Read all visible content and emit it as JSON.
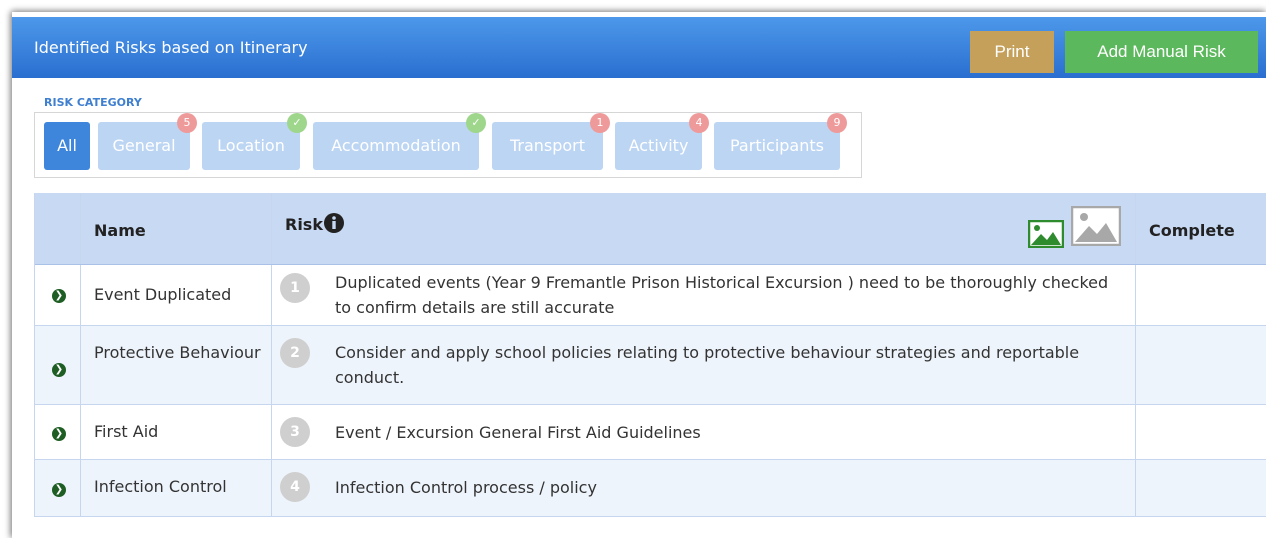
{
  "header": {
    "title": "Identified Risks based on Itinerary",
    "print_label": "Print",
    "add_label": "Add Manual Risk"
  },
  "categories": {
    "label": "RISK CATEGORY",
    "items": [
      {
        "label": "All",
        "active": true,
        "badge": ""
      },
      {
        "label": "General",
        "active": false,
        "badge": "5",
        "badge_type": "count"
      },
      {
        "label": "Location",
        "active": false,
        "badge": "✓",
        "badge_type": "check"
      },
      {
        "label": "Accommodation",
        "active": false,
        "badge": "✓",
        "badge_type": "check"
      },
      {
        "label": "Transport",
        "active": false,
        "badge": "1",
        "badge_type": "count"
      },
      {
        "label": "Activity",
        "active": false,
        "badge": "4",
        "badge_type": "count"
      },
      {
        "label": "Participants",
        "active": false,
        "badge": "9",
        "badge_type": "count"
      }
    ]
  },
  "table": {
    "headers": {
      "name": "Name",
      "risk": "Risk",
      "complete": "Complete"
    },
    "icons": [
      "info-icon",
      "image-icon-green",
      "image-icon-gray",
      "expand-arrow-icon"
    ],
    "rows": [
      {
        "num": "1",
        "name": "Event Duplicated",
        "risk": "Duplicated events (Year 9 Fremantle Prison Historical Excursion ) need to be thoroughly checked to confirm details are still accurate"
      },
      {
        "num": "2",
        "name": "Protective Behaviour",
        "risk": "Consider and apply school policies relating to protective behaviour strategies and reportable conduct."
      },
      {
        "num": "3",
        "name": "First Aid",
        "risk": "Event / Excursion General First Aid Guidelines"
      },
      {
        "num": "4",
        "name": "Infection Control",
        "risk": "Infection Control process / policy"
      }
    ]
  },
  "colors": {
    "header_blue": "#3a82dd",
    "print_gold": "#c5a05a",
    "add_green": "#5cb85c",
    "category_active": "#3d86db",
    "category_inactive": "#bcd5f3",
    "badge_red": "#ef9a9a",
    "badge_green": "#9ed68b",
    "table_header": "#c8d9f3"
  }
}
